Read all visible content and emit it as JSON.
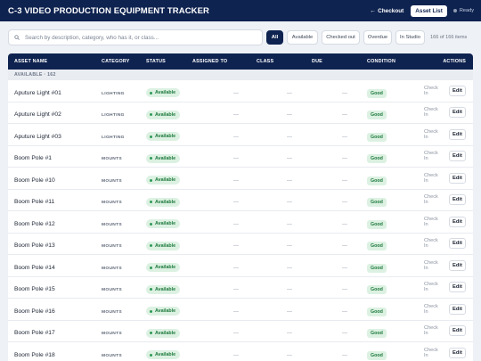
{
  "header": {
    "title": "C-3 VIDEO PRODUCTION EQUIPMENT TRACKER",
    "checkout_label": "Checkout",
    "checkout_arrow": "←",
    "asset_list_label": "Asset List",
    "status_text": "Ready"
  },
  "toolbar": {
    "search_placeholder": "Search by description, category, who has it, or class...",
    "filters": [
      "All",
      "Available",
      "Checked out",
      "Overdue",
      "In Studio"
    ],
    "active_filter": "All",
    "count_text": "166 of 166 items"
  },
  "table": {
    "columns": [
      "ASSET NAME",
      "CATEGORY",
      "STATUS",
      "ASSIGNED TO",
      "CLASS",
      "DUE",
      "CONDITION",
      "ACTIONS"
    ],
    "group_label": "AVAILABLE · 162",
    "rows": [
      {
        "name": "Aputure Light #01",
        "category": "LIGHTING",
        "status": "Available",
        "assigned": "—",
        "class": "—",
        "due": "—",
        "condition": "Good",
        "checkin": "Check In",
        "edit": "Edit"
      },
      {
        "name": "Aputure Light #02",
        "category": "LIGHTING",
        "status": "Available",
        "assigned": "—",
        "class": "—",
        "due": "—",
        "condition": "Good",
        "checkin": "Check In",
        "edit": "Edit"
      },
      {
        "name": "Aputure Light #03",
        "category": "LIGHTING",
        "status": "Available",
        "assigned": "—",
        "class": "—",
        "due": "—",
        "condition": "Good",
        "checkin": "Check In",
        "edit": "Edit"
      },
      {
        "name": "Boom Pole #1",
        "category": "MOUNTS",
        "status": "Available",
        "assigned": "—",
        "class": "—",
        "due": "—",
        "condition": "Good",
        "checkin": "Check In",
        "edit": "Edit"
      },
      {
        "name": "Boom Pole #10",
        "category": "MOUNTS",
        "status": "Available",
        "assigned": "—",
        "class": "—",
        "due": "—",
        "condition": "Good",
        "checkin": "Check In",
        "edit": "Edit"
      },
      {
        "name": "Boom Pole #11",
        "category": "MOUNTS",
        "status": "Available",
        "assigned": "—",
        "class": "—",
        "due": "—",
        "condition": "Good",
        "checkin": "Check In",
        "edit": "Edit"
      },
      {
        "name": "Boom Pole #12",
        "category": "MOUNTS",
        "status": "Available",
        "assigned": "—",
        "class": "—",
        "due": "—",
        "condition": "Good",
        "checkin": "Check In",
        "edit": "Edit"
      },
      {
        "name": "Boom Pole #13",
        "category": "MOUNTS",
        "status": "Available",
        "assigned": "—",
        "class": "—",
        "due": "—",
        "condition": "Good",
        "checkin": "Check In",
        "edit": "Edit"
      },
      {
        "name": "Boom Pole #14",
        "category": "MOUNTS",
        "status": "Available",
        "assigned": "—",
        "class": "—",
        "due": "—",
        "condition": "Good",
        "checkin": "Check In",
        "edit": "Edit"
      },
      {
        "name": "Boom Pole #15",
        "category": "MOUNTS",
        "status": "Available",
        "assigned": "—",
        "class": "—",
        "due": "—",
        "condition": "Good",
        "checkin": "Check In",
        "edit": "Edit"
      },
      {
        "name": "Boom Pole #16",
        "category": "MOUNTS",
        "status": "Available",
        "assigned": "—",
        "class": "—",
        "due": "—",
        "condition": "Good",
        "checkin": "Check In",
        "edit": "Edit"
      },
      {
        "name": "Boom Pole #17",
        "category": "MOUNTS",
        "status": "Available",
        "assigned": "—",
        "class": "—",
        "due": "—",
        "condition": "Good",
        "checkin": "Check In",
        "edit": "Edit"
      },
      {
        "name": "Boom Pole #18",
        "category": "MOUNTS",
        "status": "Available",
        "assigned": "—",
        "class": "—",
        "due": "—",
        "condition": "Good",
        "checkin": "Check In",
        "edit": "Edit"
      }
    ]
  },
  "colors": {
    "navy": "#0f2350",
    "available_bg": "#dcf1e2",
    "available_fg": "#1e7a3d",
    "page_bg": "#eef1f5"
  },
  "icons": {
    "search": "search-icon",
    "status_dot": "ready-dot-icon"
  }
}
